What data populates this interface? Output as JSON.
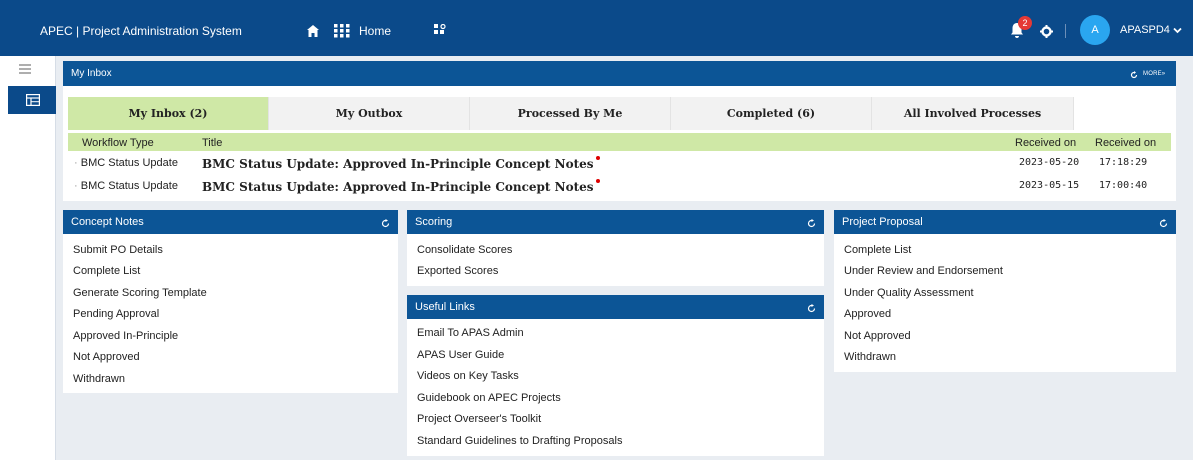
{
  "topbar": {
    "app_title": "APEC | Project Administration System",
    "home_label": "Home",
    "notification_count": "2",
    "avatar_initial": "A",
    "user_name": "APASPD4"
  },
  "inbox": {
    "title": "My Inbox",
    "more_label": "MORE»",
    "tabs": [
      "My Inbox (2)",
      "My Outbox",
      "Processed By Me",
      "Completed (6)",
      "All Involved Processes"
    ],
    "columns": [
      "Workflow Type",
      "Title",
      "Received on",
      "Received on"
    ],
    "rows": [
      {
        "workflow": "BMC Status Update",
        "title": "BMC Status Update: Approved In-Principle Concept Notes",
        "date": "2023-05-20",
        "time": "17:18:29"
      },
      {
        "workflow": "BMC Status Update",
        "title": "BMC Status Update: Approved In-Principle Concept Notes",
        "date": "2023-05-15",
        "time": "17:00:40"
      }
    ]
  },
  "concept_notes": {
    "title": "Concept Notes",
    "items": [
      "Submit PO Details",
      "Complete List",
      "Generate Scoring Template",
      "Pending Approval",
      "Approved In-Principle",
      "Not Approved",
      "Withdrawn"
    ]
  },
  "scoring": {
    "title": "Scoring",
    "items": [
      "Consolidate Scores",
      "Exported Scores"
    ]
  },
  "useful_links": {
    "title": "Useful Links",
    "items": [
      "Email To APAS Admin",
      "APAS User Guide",
      "Videos on Key Tasks",
      "Guidebook on APEC Projects",
      "Project Overseer's Toolkit",
      "Standard Guidelines to Drafting Proposals"
    ]
  },
  "project_proposal": {
    "title": "Project Proposal",
    "items": [
      "Complete List",
      "Under Review and Endorsement",
      "Under Quality Assessment",
      "Approved",
      "Not Approved",
      "Withdrawn"
    ]
  },
  "colors": {
    "header_blue": "#0b4a8a",
    "panel_blue": "#0c5596",
    "tab_green": "#cfe8a6",
    "badge_red": "#e53935",
    "avatar_blue": "#2aa6f0"
  },
  "icons": [
    "home-icon",
    "grid-icon",
    "apps-icon",
    "bell-icon",
    "gear-icon",
    "chevron-down-icon",
    "menu-icon",
    "table-icon",
    "refresh-icon"
  ]
}
